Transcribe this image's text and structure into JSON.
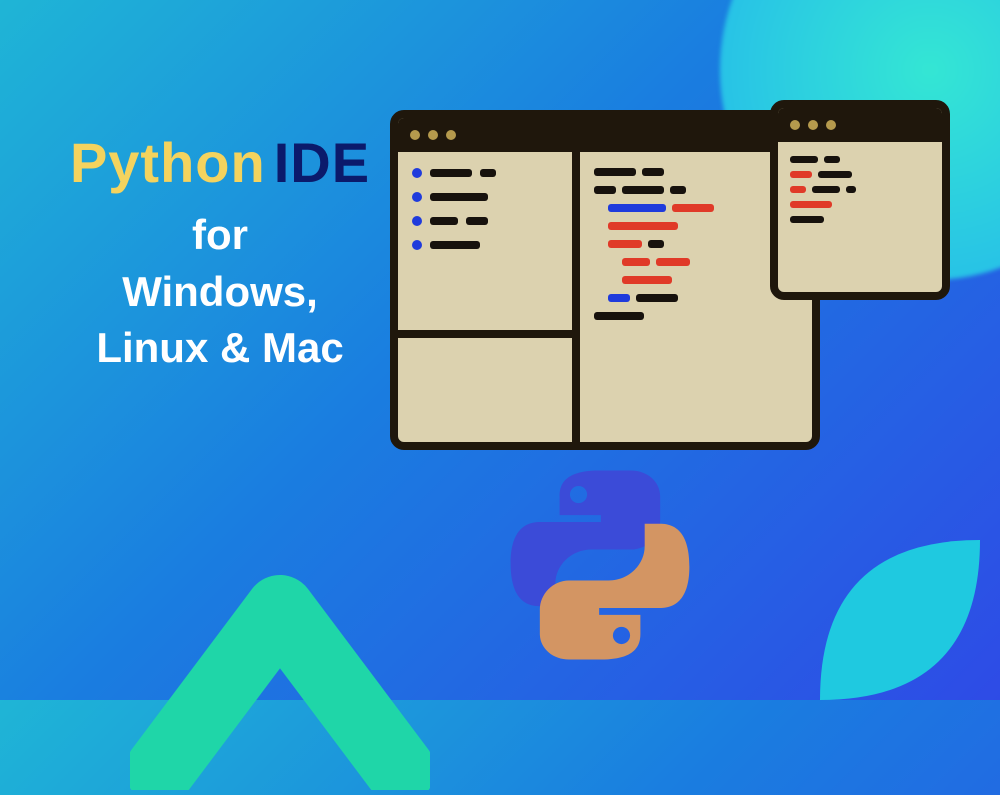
{
  "headline": {
    "word1": "Python",
    "word2": "IDE",
    "line2a": "for",
    "line2b": "Windows,",
    "line2c": "Linux & Mac"
  },
  "colors": {
    "accent_yellow": "#f4d35e",
    "accent_navy": "#0b1a6b",
    "window_border": "#1f170c",
    "window_fill": "#dcd2af",
    "code_dark": "#17120d",
    "code_red": "#e03a28",
    "code_blue": "#1f3bdc"
  },
  "icons": {
    "python_logo": "python-logo",
    "ide_window": "ide-windows"
  }
}
